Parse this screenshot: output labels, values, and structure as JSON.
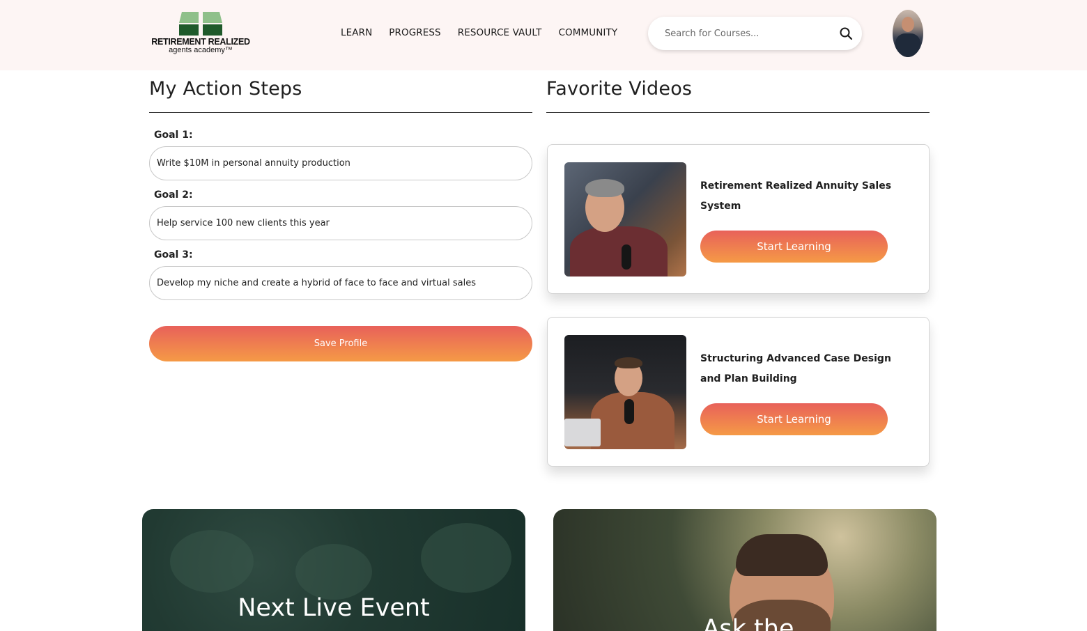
{
  "header": {
    "logo": {
      "line1": "RETIREMENT REALIZED",
      "line2": "agents academy™"
    },
    "nav": [
      {
        "label": "LEARN"
      },
      {
        "label": "PROGRESS"
      },
      {
        "label": "RESOURCE VAULT"
      },
      {
        "label": "COMMUNITY"
      }
    ],
    "search": {
      "placeholder": "Search for Courses...",
      "value": ""
    }
  },
  "action_steps": {
    "title": "My Action Steps",
    "goals": [
      {
        "label": "Goal 1:",
        "value": "Write $10M in personal annuity production"
      },
      {
        "label": "Goal 2:",
        "value": "Help service 100 new clients this year"
      },
      {
        "label": "Goal 3:",
        "value": "Develop my niche and create a hybrid of face to face and virtual sales"
      }
    ],
    "save_label": "Save Profile"
  },
  "favorite_videos": {
    "title": "Favorite Videos",
    "items": [
      {
        "title_line1": "Retirement Realized Annuity Sales",
        "title_line2": "System",
        "button": "Start Learning"
      },
      {
        "title_line1": "Structuring Advanced Case Design",
        "title_line2": "and Plan Building",
        "button": "Start Learning"
      }
    ]
  },
  "panels": {
    "event_title": "Next Live Event",
    "ask_title": "Ask the"
  },
  "colors": {
    "header_bg": "#fdf5f4",
    "accent_gradient_top": "#e8615a",
    "accent_gradient_bottom": "#f59a46",
    "logo_green_dark": "#1f5a2b",
    "logo_green_light": "#8fc08a",
    "event_panel_bg": "#213a32"
  }
}
